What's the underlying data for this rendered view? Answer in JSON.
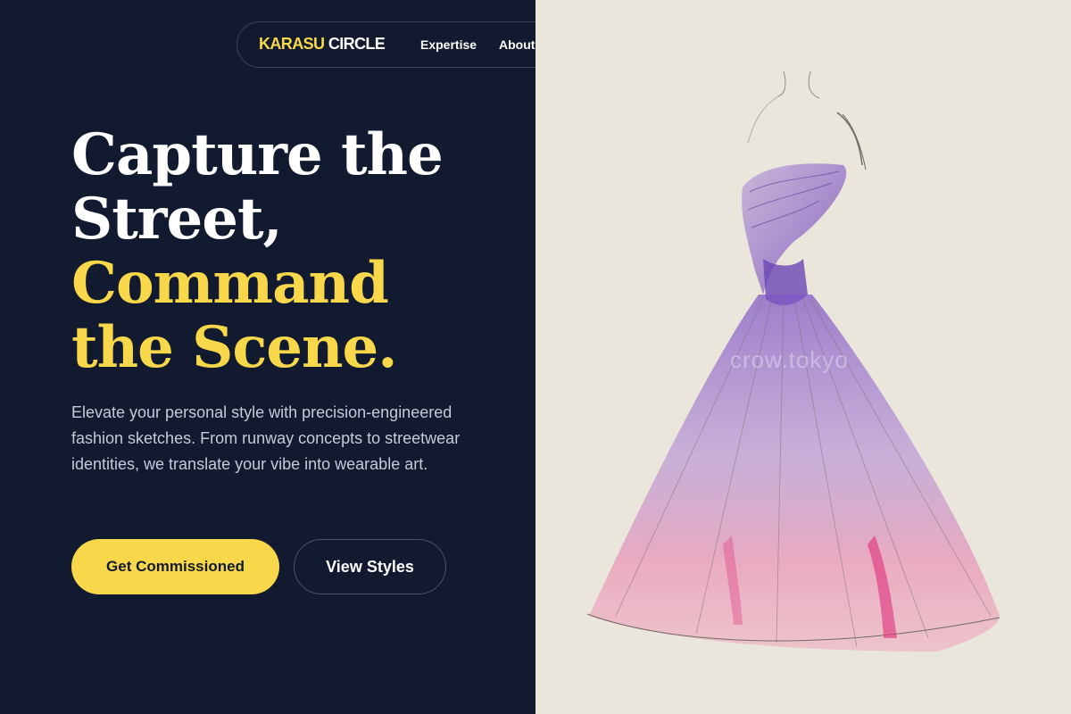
{
  "header": {
    "logo_primary": "KARASU",
    "logo_secondary": "CIRCLE",
    "nav": [
      {
        "label": "Expertise"
      },
      {
        "label": "About"
      }
    ]
  },
  "hero": {
    "headline_lines": [
      "Capture the",
      "Street,",
      "Command",
      "the Scene."
    ],
    "description": "Elevate your personal style with precision-engineered fashion sketches. From runway concepts to streetwear identities, we translate your vibe into wearable art.",
    "primary_cta": "Get Commissioned",
    "secondary_cta": "View Styles"
  },
  "illustration": {
    "watermark": "crow.tokyo"
  },
  "colors": {
    "background": "#111a2e",
    "accent": "#f8d84a",
    "text": "#ffffff",
    "muted_text": "#c5cbd6",
    "paper": "#ebe6dc"
  }
}
